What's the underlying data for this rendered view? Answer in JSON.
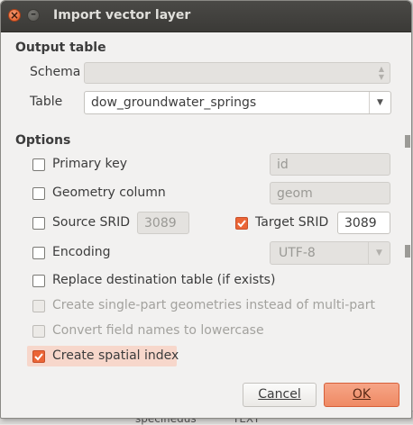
{
  "window": {
    "title": "Import vector layer"
  },
  "output_table": {
    "heading": "Output table",
    "schema_label": "Schema",
    "schema_value": "",
    "table_label": "Table",
    "table_value": "dow_groundwater_springs"
  },
  "options": {
    "heading": "Options",
    "primary_key": {
      "label": "Primary key",
      "checked": false,
      "field_value": "id"
    },
    "geometry_column": {
      "label": "Geometry column",
      "checked": false,
      "field_value": "geom"
    },
    "source_srid": {
      "label": "Source SRID",
      "checked": false,
      "field_value": "3089"
    },
    "target_srid": {
      "label": "Target SRID",
      "checked": true,
      "field_value": "3089"
    },
    "encoding": {
      "label": "Encoding",
      "checked": false,
      "value": "UTF-8"
    },
    "replace_table": {
      "label": "Replace destination table (if exists)",
      "checked": false
    },
    "single_part": {
      "label": "Create single-part geometries instead of multi-part",
      "checked": false,
      "enabled": false
    },
    "lowercase": {
      "label": "Convert field names to lowercase",
      "checked": false,
      "enabled": false
    },
    "spatial_index": {
      "label": "Create spatial index",
      "checked": true
    }
  },
  "buttons": {
    "cancel_label": "Cancel",
    "ok_label": "OK"
  },
  "background": {
    "partial_text_1": "specifiedus",
    "partial_text_2": "TEXT"
  },
  "colors": {
    "accent": "#eb6536",
    "ok_button": "#f09572",
    "titlebar": "#3d3c39",
    "dialog_bg": "#f2f1f0"
  }
}
